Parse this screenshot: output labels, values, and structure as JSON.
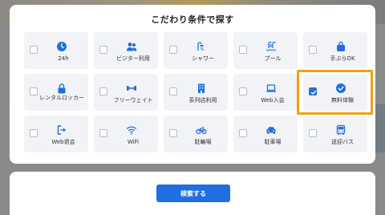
{
  "modal": {
    "title": "こだわり条件で探す"
  },
  "options": [
    {
      "label": "24h",
      "icon": "clock-icon",
      "checked": false
    },
    {
      "label": "ビジター利用",
      "icon": "users-icon",
      "checked": false
    },
    {
      "label": "シャワー",
      "icon": "shower-icon",
      "checked": false
    },
    {
      "label": "プール",
      "icon": "pool-icon",
      "checked": false
    },
    {
      "label": "手ぶらOK",
      "icon": "bag-icon",
      "checked": false
    },
    {
      "label": "レンタルロッカー",
      "icon": "lock-icon",
      "checked": false
    },
    {
      "label": "フリーウェイト",
      "icon": "dumbbell-icon",
      "checked": false
    },
    {
      "label": "系列店利用",
      "icon": "building-icon",
      "checked": false
    },
    {
      "label": "Web入会",
      "icon": "laptop-icon",
      "checked": false
    },
    {
      "label": "無料体験",
      "icon": "check-circle-icon",
      "checked": true
    },
    {
      "label": "Web退会",
      "icon": "logout-icon",
      "checked": false
    },
    {
      "label": "WiFi",
      "icon": "wifi-icon",
      "checked": false
    },
    {
      "label": "駐輪場",
      "icon": "bicycle-icon",
      "checked": false
    },
    {
      "label": "駐車場",
      "icon": "car-icon",
      "checked": false
    },
    {
      "label": "送迎バス",
      "icon": "bus-icon",
      "checked": false
    }
  ],
  "footer": {
    "search_label": "検索する"
  },
  "colors": {
    "accent": "#1f6fe0",
    "highlight": "#f0a010",
    "icon": "#1f6fe0"
  }
}
